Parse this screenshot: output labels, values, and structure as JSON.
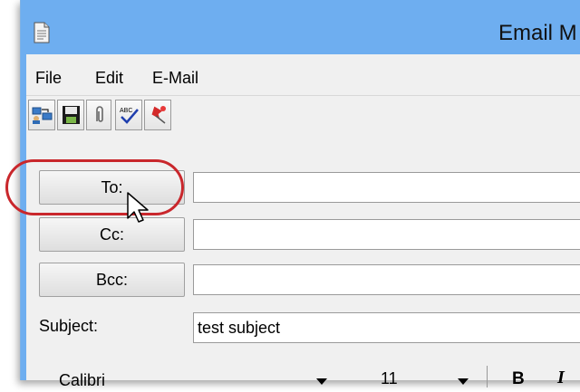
{
  "window": {
    "title": "Email M"
  },
  "menu": {
    "items": [
      "File",
      "Edit",
      "E-Mail"
    ]
  },
  "toolbar": {
    "buttons": [
      {
        "icon": "address-book-icon"
      },
      {
        "icon": "save-icon"
      },
      {
        "icon": "paperclip-icon"
      },
      {
        "icon": "spellcheck-icon"
      },
      {
        "icon": "pushpin-icon"
      }
    ]
  },
  "fields": {
    "to_label": "To:",
    "to_value": "",
    "cc_label": "Cc:",
    "cc_value": "",
    "bcc_label": "Bcc:",
    "bcc_value": "",
    "subject_label": "Subject:",
    "subject_value": "test subject"
  },
  "format": {
    "font_name": "Calibri",
    "font_size": "11",
    "bold_label": "B",
    "italic_label": "I"
  },
  "colors": {
    "title_bar": "#6eaef0",
    "highlight": "#c9272c"
  }
}
